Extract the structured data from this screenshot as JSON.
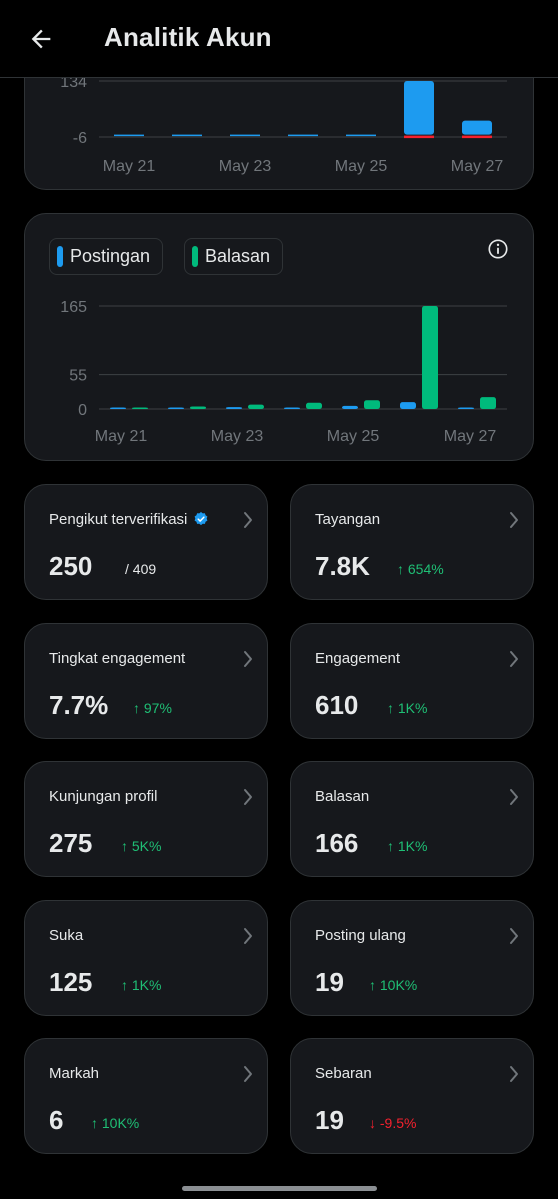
{
  "header": {
    "title": "Analitik Akun",
    "back_icon": "arrow-left-icon"
  },
  "top_chart": {
    "y_ticks": [
      "134",
      "-6"
    ],
    "x_ticks": [
      "May 21",
      "May 23",
      "May 25",
      "May 27"
    ]
  },
  "main_chart": {
    "legend": [
      {
        "label": "Postingan",
        "color": "#1d9bf0"
      },
      {
        "label": "Balasan",
        "color": "#00ba7c"
      }
    ],
    "y_ticks": [
      "165",
      "55",
      "0"
    ],
    "x_ticks": [
      "May 21",
      "May 23",
      "May 25",
      "May 27"
    ],
    "info_icon": "info-icon"
  },
  "chart_data": [
    {
      "type": "bar",
      "categories": [
        "May 21",
        "May 22",
        "May 23",
        "May 24",
        "May 25",
        "May 26",
        "May 27"
      ],
      "ylim": [
        -6,
        134
      ],
      "series": [
        {
          "values": [
            0,
            0,
            0,
            0,
            0,
            134,
            35
          ]
        }
      ]
    },
    {
      "type": "bar",
      "categories": [
        "May 21",
        "May 22",
        "May 23",
        "May 24",
        "May 25",
        "May 26",
        "May 27"
      ],
      "ylim": [
        0,
        165
      ],
      "series": [
        {
          "name": "Postingan",
          "values": [
            0,
            0,
            3,
            2,
            5,
            11,
            1
          ]
        },
        {
          "name": "Balasan",
          "values": [
            2,
            4,
            7,
            10,
            14,
            165,
            19
          ]
        }
      ]
    }
  ],
  "stats": [
    {
      "label": "Pengikut terverifikasi",
      "value": "250",
      "sub": "/ 409",
      "verified": true
    },
    {
      "label": "Tayangan",
      "value": "7.8K",
      "change": "654%",
      "direction": "up"
    },
    {
      "label": "Tingkat engagement",
      "value": "7.7%",
      "change": "97%",
      "direction": "up"
    },
    {
      "label": "Engagement",
      "value": "610",
      "change": "1K%",
      "direction": "up"
    },
    {
      "label": "Kunjungan profil",
      "value": "275",
      "change": "5K%",
      "direction": "up"
    },
    {
      "label": "Balasan",
      "value": "166",
      "change": "1K%",
      "direction": "up"
    },
    {
      "label": "Suka",
      "value": "125",
      "change": "1K%",
      "direction": "up"
    },
    {
      "label": "Posting ulang",
      "value": "19",
      "change": "10K%",
      "direction": "up"
    },
    {
      "label": "Markah",
      "value": "6",
      "change": "10K%",
      "direction": "up"
    },
    {
      "label": "Sebaran",
      "value": "19",
      "change": "-9.5%",
      "direction": "down"
    }
  ],
  "colors": {
    "up": "#1fbf75",
    "down": "#f4212e",
    "blue": "#1d9bf0",
    "green": "#00ba7c"
  }
}
